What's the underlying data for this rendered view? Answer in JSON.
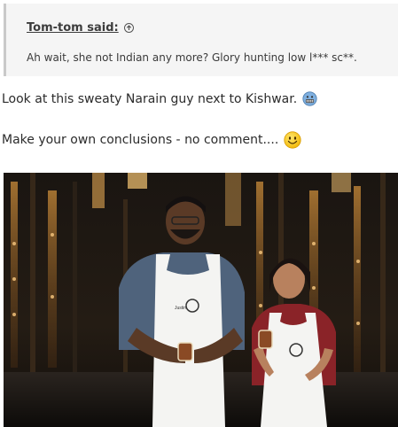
{
  "quote": {
    "author": "Tom-tom said:",
    "author_icon": "arrow-up-circle-icon",
    "text": "Ah wait, she not Indian any more? Glory hunting low l*** sc**."
  },
  "post": {
    "line1": "Look at this sweaty Narain guy next to Kishwar.",
    "line1_emoji": "grimace-emoji",
    "line2": "Make your own conclusions - no comment....",
    "line2_emoji": "smile-emoji"
  },
  "photo": {
    "description_icon": "masterchef-contestants-photo",
    "apron_name": "Justin"
  }
}
